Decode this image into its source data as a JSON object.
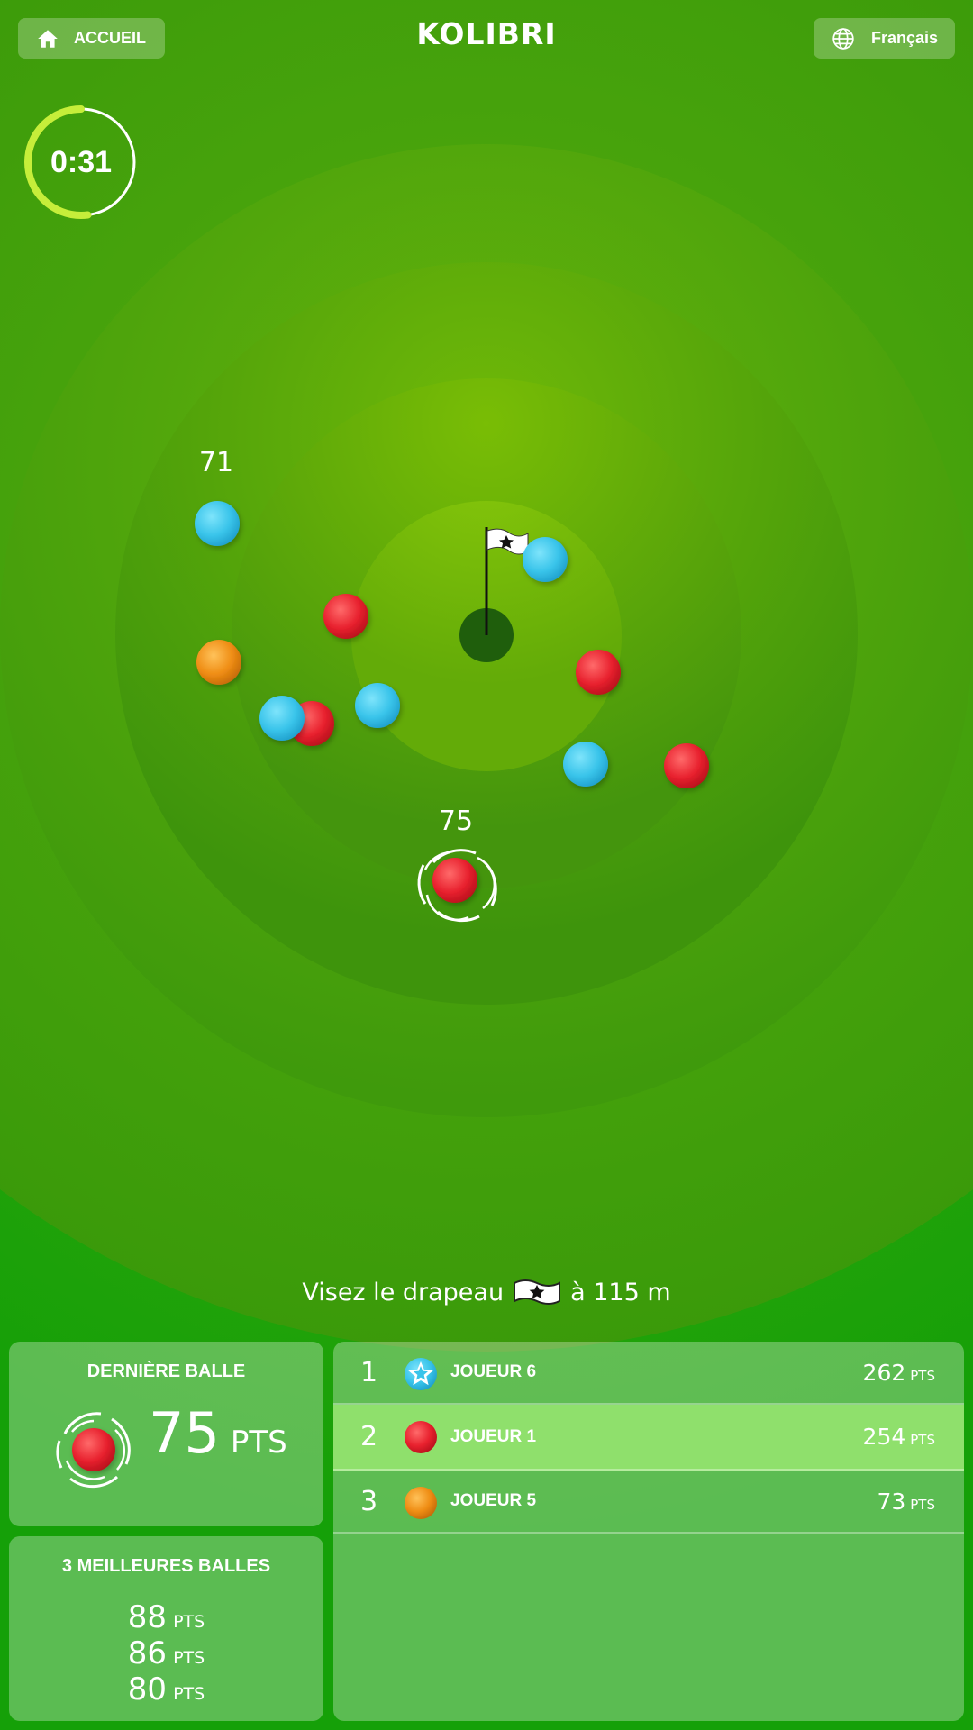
{
  "header": {
    "home_label": "ACCUEIL",
    "app_title": "KOLIBRI",
    "language_label": "Français"
  },
  "timer": {
    "text": "0:31",
    "remaining_fraction": 0.52
  },
  "colors": {
    "player_blue": "#39c4ea",
    "player_red": "#e8212e",
    "player_orange": "#ef8d14",
    "timer_ring": "#c6ee3a",
    "hole": "#1f5e0c",
    "highlight_row": "#8fe06c"
  },
  "field": {
    "balls": [
      {
        "color": "blue",
        "label": "71"
      },
      {
        "color": "blue"
      },
      {
        "color": "red"
      },
      {
        "color": "orange"
      },
      {
        "color": "red"
      },
      {
        "color": "blue"
      },
      {
        "color": "blue"
      },
      {
        "color": "red"
      },
      {
        "color": "blue"
      },
      {
        "color": "red"
      },
      {
        "color": "red",
        "label": "75",
        "last_shot": true
      }
    ]
  },
  "hint": {
    "before_flag": "Visez le drapeau",
    "after_flag": "à 115 m",
    "flag_icon": "flag-star-icon"
  },
  "last_ball": {
    "title": "DERNIÈRE BALLE",
    "score": "75",
    "unit": "PTS",
    "ball_color": "red"
  },
  "best_balls": {
    "title": "3 MEILLEURES BALLES",
    "items": [
      {
        "score": "88",
        "unit": "PTS"
      },
      {
        "score": "86",
        "unit": "PTS"
      },
      {
        "score": "80",
        "unit": "PTS"
      }
    ]
  },
  "ranking": [
    {
      "rank": "1",
      "name": "JOUEUR 6",
      "score": "262",
      "unit": "PTS",
      "icon": "star-badge-icon",
      "color": "blue",
      "highlight": false
    },
    {
      "rank": "2",
      "name": "JOUEUR 1",
      "score": "254",
      "unit": "PTS",
      "icon": "red-ball-icon",
      "color": "red",
      "highlight": true
    },
    {
      "rank": "3",
      "name": "JOUEUR 5",
      "score": "73",
      "unit": "PTS",
      "icon": "orange-ball-icon",
      "color": "orange",
      "highlight": false
    }
  ]
}
